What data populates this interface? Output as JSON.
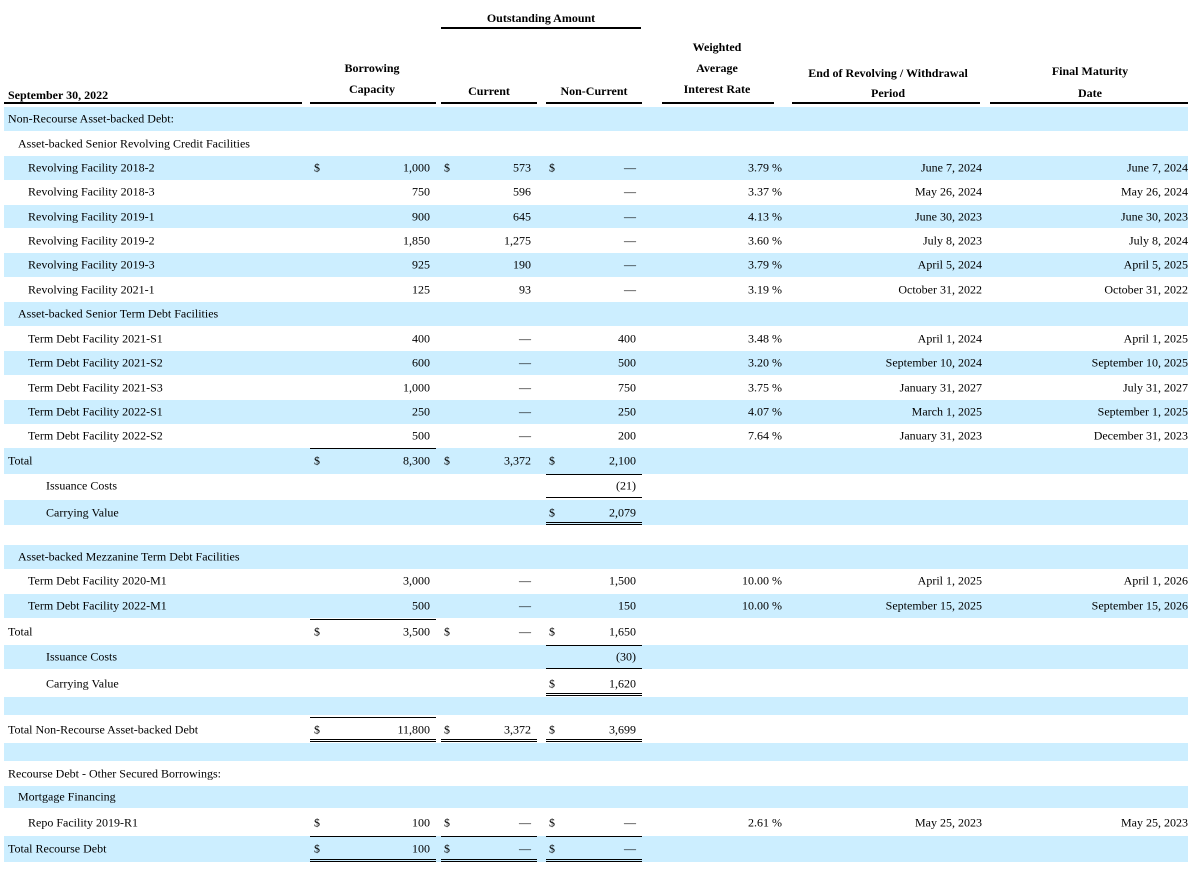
{
  "header": {
    "date_label": "September 30, 2022",
    "outstanding_amount": "Outstanding Amount",
    "borrowing_capacity_l1": "Borrowing",
    "borrowing_capacity_l2": "Capacity",
    "current": "Current",
    "non_current": "Non-Current",
    "weighted_l1": "Weighted",
    "weighted_l2": "Average",
    "weighted_l3": "Interest Rate",
    "end_rev_l1": "End of Revolving / Withdrawal",
    "end_rev_l2": "Period",
    "final_mat_l1": "Final Maturity",
    "final_mat_l2": "Date"
  },
  "rows": [
    {
      "label": "Non-Recourse Asset-backed Debt:",
      "indent": 0
    },
    {
      "label": "Asset-backed Senior Revolving Credit Facilities",
      "indent": 1
    },
    {
      "label": "Revolving Facility 2018-2",
      "indent": 2,
      "cap_dollar": "$",
      "cap": "1,000",
      "cur_dollar": "$",
      "cur": "573",
      "nc_dollar": "$",
      "nc": "—",
      "rate": "3.79 %",
      "end": "June 7, 2024",
      "final": "June 7, 2024"
    },
    {
      "label": "Revolving Facility 2018-3",
      "indent": 2,
      "cap": "750",
      "cur": "596",
      "nc": "—",
      "rate": "3.37 %",
      "end": "May 26, 2024",
      "final": "May 26, 2024"
    },
    {
      "label": "Revolving Facility 2019-1",
      "indent": 2,
      "cap": "900",
      "cur": "645",
      "nc": "—",
      "rate": "4.13 %",
      "end": "June 30, 2023",
      "final": "June 30, 2023"
    },
    {
      "label": "Revolving Facility 2019-2",
      "indent": 2,
      "cap": "1,850",
      "cur": "1,275",
      "nc": "—",
      "rate": "3.60 %",
      "end": "July 8, 2023",
      "final": "July 8, 2024"
    },
    {
      "label": "Revolving Facility 2019-3",
      "indent": 2,
      "cap": "925",
      "cur": "190",
      "nc": "—",
      "rate": "3.79 %",
      "end": "April 5, 2024",
      "final": "April 5, 2025"
    },
    {
      "label": "Revolving Facility 2021-1",
      "indent": 2,
      "cap": "125",
      "cur": "93",
      "nc": "—",
      "rate": "3.19 %",
      "end": "October 31, 2022",
      "final": "October 31, 2022"
    },
    {
      "label": "Asset-backed Senior Term Debt Facilities",
      "indent": 1
    },
    {
      "label": "Term Debt Facility 2021-S1",
      "indent": 2,
      "cap": "400",
      "cur": "—",
      "nc": "400",
      "rate": "3.48 %",
      "end": "April 1, 2024",
      "final": "April 1, 2025"
    },
    {
      "label": "Term Debt Facility 2021-S2",
      "indent": 2,
      "cap": "600",
      "cur": "—",
      "nc": "500",
      "rate": "3.20 %",
      "end": "September 10, 2024",
      "final": "September 10, 2025"
    },
    {
      "label": "Term Debt Facility 2021-S3",
      "indent": 2,
      "cap": "1,000",
      "cur": "—",
      "nc": "750",
      "rate": "3.75 %",
      "end": "January 31, 2027",
      "final": "July 31, 2027"
    },
    {
      "label": "Term Debt Facility 2022-S1",
      "indent": 2,
      "cap": "250",
      "cur": "—",
      "nc": "250",
      "rate": "4.07 %",
      "end": "March 1, 2025",
      "final": "September 1, 2025"
    },
    {
      "label": "Term Debt Facility 2022-S2",
      "indent": 2,
      "cap": "500",
      "cur": "—",
      "nc": "200",
      "rate": "7.64 %",
      "end": "January 31, 2023",
      "final": "December 31, 2023"
    },
    {
      "label": "Total",
      "indent": 0,
      "cap_dollar": "$",
      "cap": "8,300",
      "cur_dollar": "$",
      "cur": "3,372",
      "nc_dollar": "$",
      "nc": "2,100"
    },
    {
      "label": "Issuance Costs",
      "indent": 3,
      "nc": "(21)"
    },
    {
      "label": "Carrying Value",
      "indent": 3,
      "nc_dollar": "$",
      "nc": "2,079"
    },
    {
      "label": "",
      "indent": 0
    },
    {
      "label": "Asset-backed Mezzanine Term Debt Facilities",
      "indent": 1
    },
    {
      "label": "Term Debt Facility 2020-M1",
      "indent": 2,
      "cap": "3,000",
      "cur": "—",
      "nc": "1,500",
      "rate": "10.00 %",
      "end": "April 1, 2025",
      "final": "April 1, 2026"
    },
    {
      "label": "Term Debt Facility 2022-M1",
      "indent": 2,
      "cap": "500",
      "cur": "—",
      "nc": "150",
      "rate": "10.00 %",
      "end": "September 15, 2025",
      "final": "September 15, 2026"
    },
    {
      "label": "Total",
      "indent": 0,
      "cap_dollar": "$",
      "cap": "3,500",
      "cur_dollar": "$",
      "cur": "—",
      "nc_dollar": "$",
      "nc": "1,650"
    },
    {
      "label": "Issuance Costs",
      "indent": 3,
      "nc": "(30)"
    },
    {
      "label": "Carrying Value",
      "indent": 3,
      "nc_dollar": "$",
      "nc": "1,620"
    },
    {
      "label": "",
      "indent": 0
    },
    {
      "label": "Total Non-Recourse Asset-backed Debt",
      "indent": 0,
      "cap_dollar": "$",
      "cap": "11,800",
      "cur_dollar": "$",
      "cur": "3,372",
      "nc_dollar": "$",
      "nc": "3,699"
    },
    {
      "label": "",
      "indent": 0
    },
    {
      "label": "Recourse Debt - Other Secured Borrowings:",
      "indent": 0
    },
    {
      "label": "Mortgage Financing",
      "indent": 1
    },
    {
      "label": "Repo Facility 2019-R1",
      "indent": 2,
      "cap_dollar": "$",
      "cap": "100",
      "cur_dollar": "$",
      "cur": "—",
      "nc_dollar": "$",
      "nc": "—",
      "rate": "2.61 %",
      "end": "May 25, 2023",
      "final": "May 25, 2023"
    },
    {
      "label": "Total Recourse Debt",
      "indent": 0,
      "cap_dollar": "$",
      "cap": "100",
      "cur_dollar": "$",
      "cur": "—",
      "nc_dollar": "$",
      "nc": "—"
    }
  ]
}
